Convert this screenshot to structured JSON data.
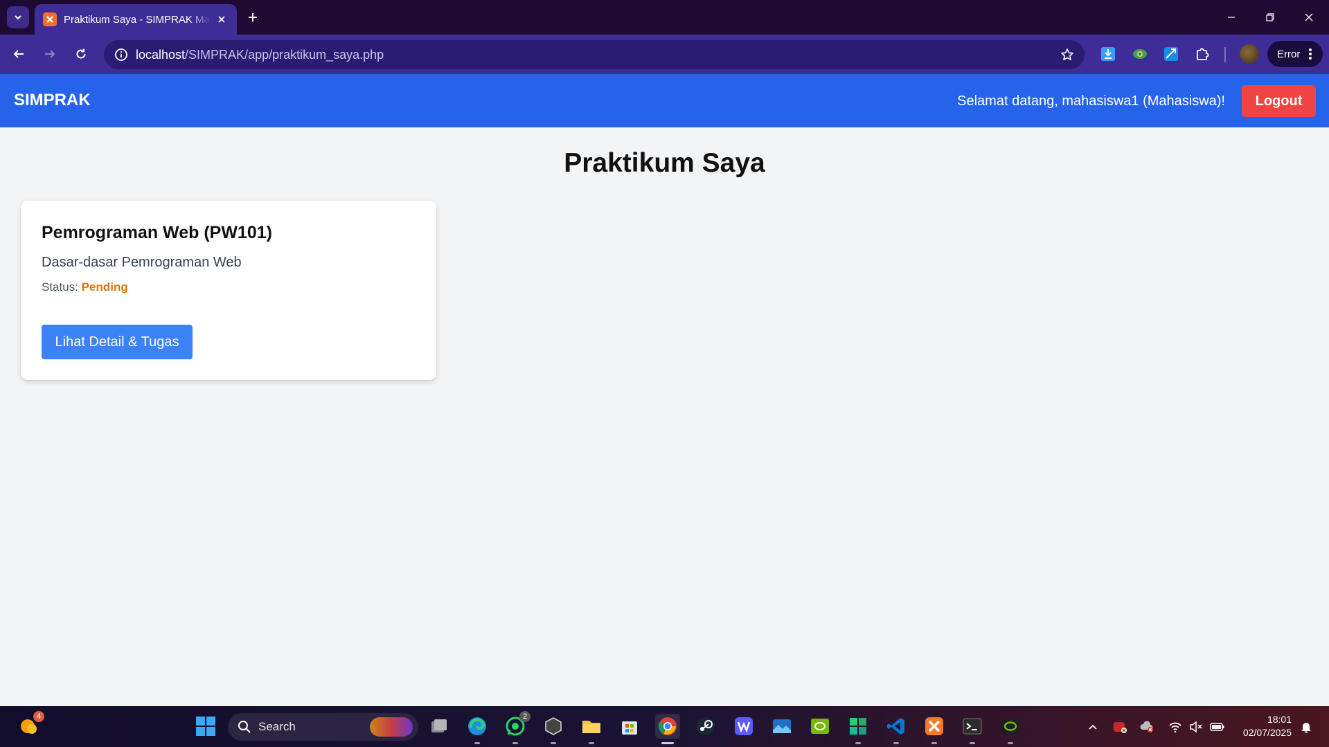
{
  "browser": {
    "tab_title": "Praktikum Saya - SIMPRAK Mahasiswa",
    "url_host": "localhost",
    "url_path": "/SIMPRAK/app/praktikum_saya.php",
    "profile_status": "Error"
  },
  "navbar": {
    "brand": "SIMPRAK",
    "welcome": "Selamat datang, mahasiswa1 (Mahasiswa)!",
    "logout_label": "Logout"
  },
  "page": {
    "title": "Praktikum Saya"
  },
  "courses": [
    {
      "title": "Pemrograman Web (PW101)",
      "description": "Dasar-dasar Pemrograman Web",
      "status_label": "Status:",
      "status_value": "Pending",
      "button_label": "Lihat Detail & Tugas"
    }
  ],
  "taskbar": {
    "search_placeholder": "Search",
    "weather_badge": "4",
    "whatsapp_badge": "2",
    "time": "18:01",
    "date": "02/07/2025",
    "pinned": [
      "widgets-icon",
      "start-icon",
      "search",
      "task-view-icon",
      "edge-icon",
      "whatsapp-icon",
      "app-icon",
      "file-explorer-icon",
      "store-icon",
      "chrome-icon",
      "steam-icon",
      "w-app-icon",
      "photos-icon",
      "nvidia-icon",
      "app-icon-2",
      "vscode-icon",
      "xampp-icon",
      "terminal-icon",
      "nvidia-app-icon"
    ]
  },
  "colors": {
    "nav_bg": "#2563eb",
    "logout_bg": "#ef4444",
    "button_bg": "#3b82f6",
    "status_pending": "#d97706",
    "page_bg": "#f3f4f6"
  }
}
